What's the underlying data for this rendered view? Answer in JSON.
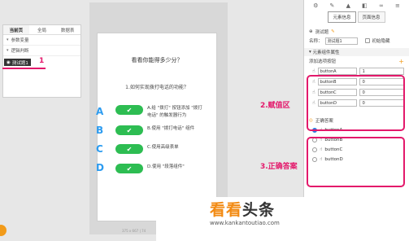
{
  "left": {
    "tabs": [
      "当前页",
      "全局",
      "数据表"
    ],
    "sections": [
      "参数变量",
      "逻辑判断",
      "变量"
    ],
    "layer_label": "测试题1",
    "badge": "1"
  },
  "canvas": {
    "title": "看看你能得多少分？",
    "question": "1.如何实现拨打电话的功能？",
    "options": [
      {
        "letter": "A",
        "check": "✔",
        "text": "A.给 \"拨打\" 按钮添加 \"拨打电话\" 的触发器行为"
      },
      {
        "letter": "B",
        "check": "✔",
        "text": "B.使用 \"拨打电话\" 组件"
      },
      {
        "letter": "C",
        "check": "✔",
        "text": "C.使用高级表单"
      },
      {
        "letter": "D",
        "check": "✔",
        "text": "D.使用 \"段落组件\""
      }
    ],
    "footer": "375 x 667 | 74"
  },
  "right": {
    "tabs": [
      "元素信息",
      "页面信息"
    ],
    "component_title": "测试题",
    "name_label": "名称：",
    "name_value": "测试题1",
    "initial_hidden": "初始隐藏",
    "props_header": "元素组件属性",
    "add_options": "添加选项按钮",
    "options": [
      {
        "name": "buttonA",
        "value": "1"
      },
      {
        "name": "buttonB",
        "value": "0"
      },
      {
        "name": "buttonC",
        "value": "0"
      },
      {
        "name": "buttonD",
        "value": "0"
      }
    ],
    "correct_header": "正确答案",
    "answers": [
      "buttonA",
      "buttonB",
      "buttonC",
      "buttonD"
    ]
  },
  "annotations": {
    "assign": "2.赋值区",
    "answer": "3.正确答案"
  },
  "watermark": {
    "part1": "看看",
    "part2": "头条",
    "url": "www.kankantoutiao.com"
  }
}
